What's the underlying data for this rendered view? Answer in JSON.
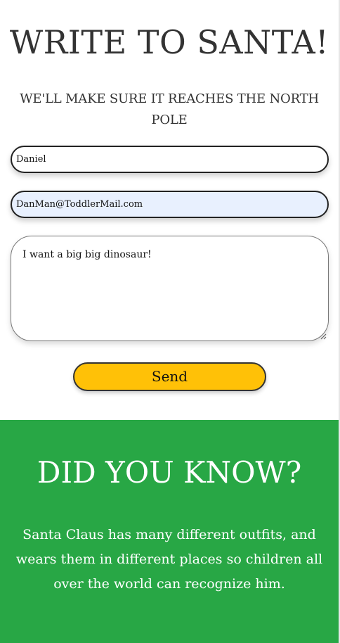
{
  "header": {
    "title": "WRITE TO SANTA!",
    "subtitle": "WE'LL MAKE SURE IT REACHES THE NORTH POLE"
  },
  "form": {
    "name_value": "Daniel",
    "email_value": "DanMan@ToddlerMail.com",
    "message_value": "I want a big big dinosaur!",
    "send_label": "Send"
  },
  "facts": {
    "title": "DID YOU KNOW?",
    "text": "Santa Claus has many different outfits, and wears them in different places so children all over the world can recognize him."
  },
  "colors": {
    "send_button": "#ffc107",
    "facts_background": "#28a745",
    "email_autofill_background": "#e8f0fe"
  }
}
